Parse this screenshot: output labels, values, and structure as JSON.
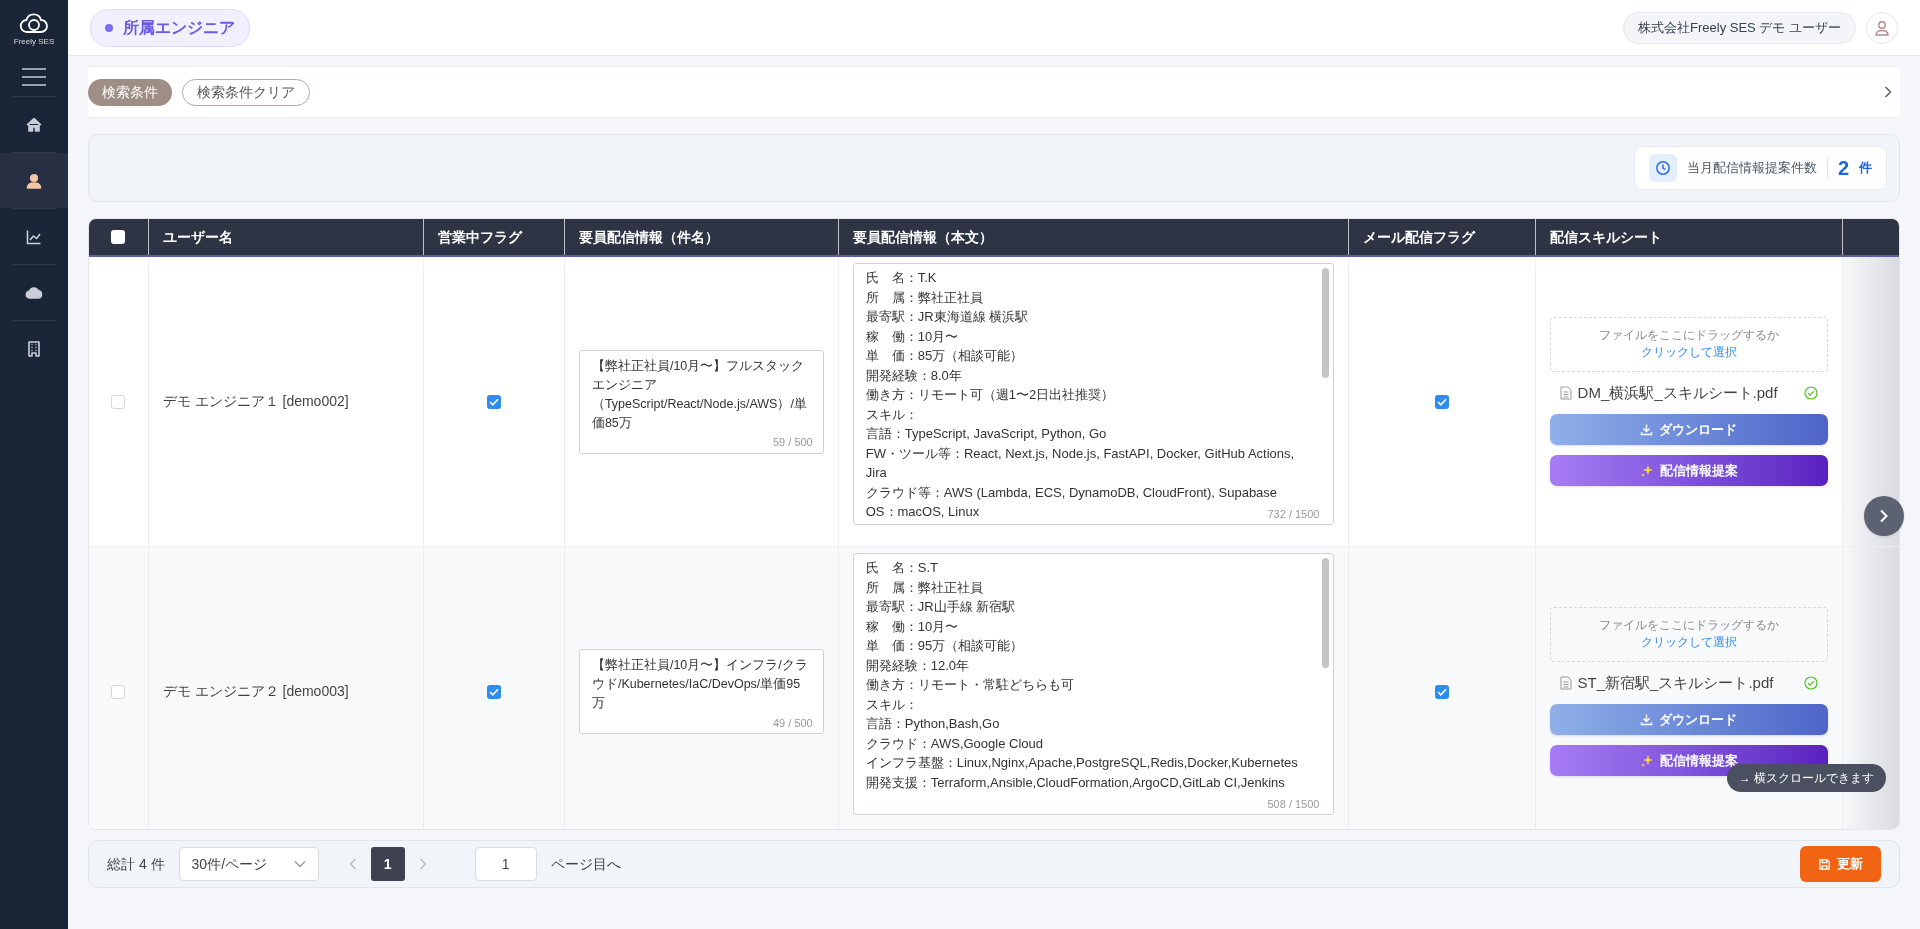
{
  "sidebar": {
    "logo_text": "Freely SES",
    "items": [
      {
        "kind": "home",
        "selected": false
      },
      {
        "kind": "user",
        "selected": true
      },
      {
        "kind": "chart",
        "selected": false
      },
      {
        "kind": "cloud",
        "selected": false
      },
      {
        "kind": "building",
        "selected": false
      }
    ]
  },
  "header": {
    "page_title": "所属エンジニア",
    "user_name": "株式会社Freely SES デモ ユーザー"
  },
  "search": {
    "label": "検索条件",
    "clear_button": "検索条件クリア"
  },
  "stats": {
    "label": "当月配信情報提案件数",
    "count": "2",
    "unit": "件"
  },
  "table": {
    "select_all": {
      "selected": false
    },
    "columns": [
      "ユーザー名",
      "営業中フラグ",
      "要員配信情報（件名）",
      "要員配信情報（本文）",
      "メール配信フラグ",
      "配信スキルシート"
    ],
    "rows": [
      {
        "selected": false,
        "user": "デモ エンジニア１ [demo002]",
        "sales_flag": true,
        "subject": "【弊社正社員/10月〜】フルスタックエンジニア（TypeScript/React/Node.js/AWS）/単価85万",
        "subject_count": "59 / 500",
        "body_lines": [
          "氏　名：T.K",
          "所　属：弊社正社員",
          "最寄駅：JR東海道線 横浜駅",
          "稼　働：10月〜",
          "単　価：85万（相談可能）",
          "開発経験：8.0年",
          "働き方：リモート可（週1〜2日出社推奨）",
          "スキル：",
          "言語：TypeScript, JavaScript, Python, Go",
          "FW・ツール等：React, Next.js, Node.js, FastAPI, Docker, GitHub Actions, Jira",
          "クラウド等：AWS (Lambda, ECS, DynamoDB, CloudFront), Supabase",
          "OS：macOS, Linux"
        ],
        "body_count": "732 / 1500",
        "mail_flag": true,
        "drop_text": "ファイルをここにドラッグするか",
        "drop_link": "クリックして選択",
        "file_name": "DM_横浜駅_スキルシート.pdf",
        "file_ok": true,
        "download": "ダウンロード",
        "propose": "配信情報提案"
      },
      {
        "selected": false,
        "user": "デモ エンジニア２ [demo003]",
        "sales_flag": true,
        "subject": "【弊社正社員/10月〜】インフラ/クラウド/Kubernetes/IaC/DevOps/単価95万",
        "subject_count": "49 / 500",
        "body_lines": [
          "氏　名：S.T",
          "所　属：弊社正社員",
          "最寄駅：JR山手線 新宿駅",
          "稼　働：10月〜",
          "単　価：95万（相談可能）",
          "開発経験：12.0年",
          "働き方：リモート・常駐どちらも可",
          "スキル：",
          "言語：Python,Bash,Go",
          "クラウド：AWS,Google Cloud",
          "インフラ基盤：Linux,Nginx,Apache,PostgreSQL,Redis,Docker,Kubernetes",
          "開発支援：Terraform,Ansible,CloudFormation,ArgoCD,GitLab CI,Jenkins"
        ],
        "body_count": "508 / 1500",
        "mail_flag": true,
        "drop_text": "ファイルをここにドラッグするか",
        "drop_link": "クリックして選択",
        "file_name": "ST_新宿駅_スキルシート.pdf",
        "file_ok": true,
        "download": "ダウンロード",
        "propose": "配信情報提案"
      }
    ]
  },
  "scroll_hint": "→ 横スクロールできます",
  "pagination": {
    "total": "総計 4 件",
    "page_size": "30件/ページ",
    "pages": [
      {
        "label": "1",
        "selected": true
      }
    ],
    "jump_value": "1",
    "jump_label": "ページ目へ",
    "update_button": "更新"
  }
}
